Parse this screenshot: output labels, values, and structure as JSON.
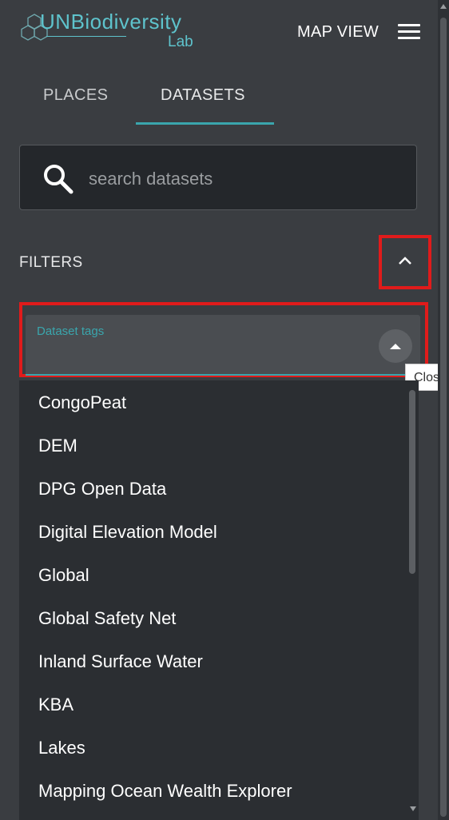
{
  "header": {
    "logo_un": "UN",
    "logo_bio": "Biodiversity",
    "logo_lab": "Lab",
    "map_view_label": "MAP VIEW"
  },
  "tabs": [
    {
      "label": "PLACES",
      "active": false
    },
    {
      "label": "DATASETS",
      "active": true
    }
  ],
  "search": {
    "placeholder": "search datasets",
    "value": ""
  },
  "filters": {
    "label": "FILTERS",
    "dataset_tags_label": "Dataset tags",
    "tooltip": "Close"
  },
  "tag_options": [
    "CongoPeat",
    "DEM",
    "DPG Open Data",
    "Digital Elevation Model",
    "Global",
    "Global Safety Net",
    "Inland Surface Water",
    "KBA",
    "Lakes",
    "Mapping Ocean Wealth Explorer"
  ],
  "colors": {
    "accent": "#3aa6ad",
    "background": "#3a3d41",
    "highlight": "#e01b1b"
  }
}
